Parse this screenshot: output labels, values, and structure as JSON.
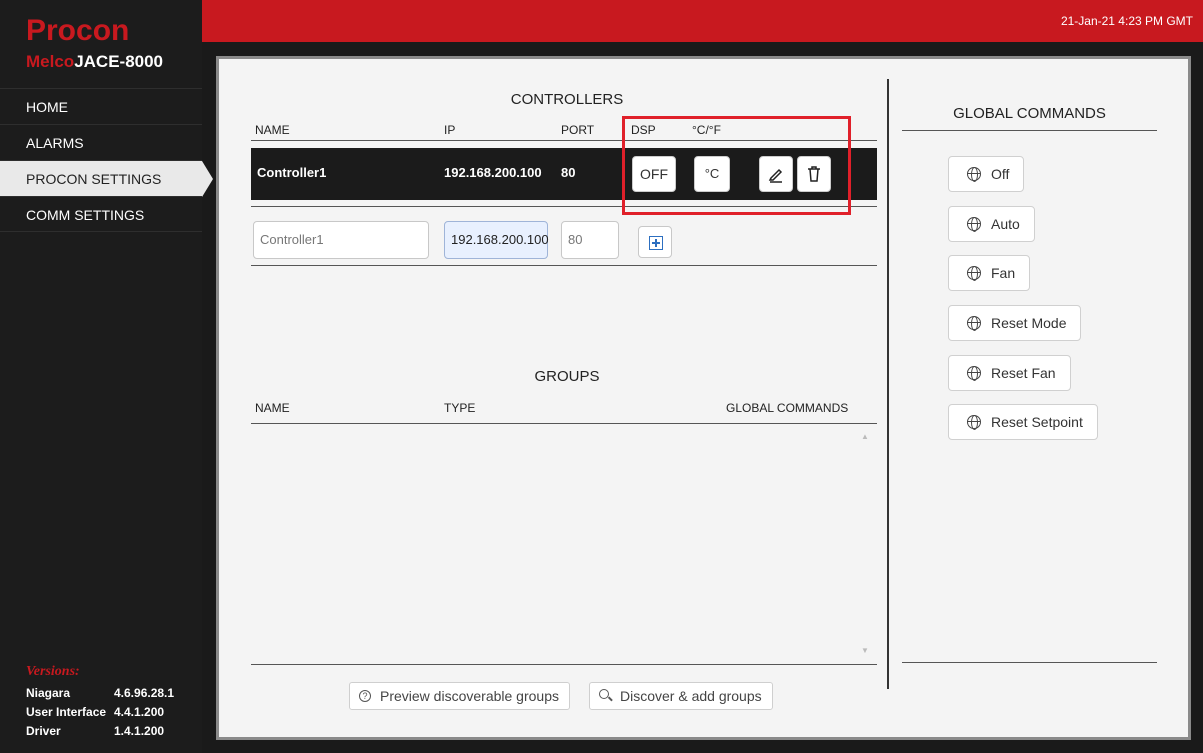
{
  "brand": {
    "name": "Procon",
    "model_prefix": "Melco",
    "model_suffix": "JACE-8000"
  },
  "datetime": "21-Jan-21 4:23 PM GMT",
  "nav": [
    {
      "label": "HOME"
    },
    {
      "label": "ALARMS"
    },
    {
      "label": "PROCON SETTINGS",
      "active": true
    },
    {
      "label": "COMM SETTINGS"
    }
  ],
  "versions": {
    "title": "Versions:",
    "rows": [
      {
        "name": "Niagara",
        "value": "4.6.96.28.1"
      },
      {
        "name": "User Interface",
        "value": "4.4.1.200"
      },
      {
        "name": "Driver",
        "value": "1.4.1.200"
      }
    ]
  },
  "controllers": {
    "title": "CONTROLLERS",
    "headers": {
      "name": "NAME",
      "ip": "IP",
      "port": "PORT",
      "dsp": "DSP",
      "unit": "°C/°F"
    },
    "row": {
      "name": "Controller1",
      "ip": "192.168.200.100",
      "port": "80",
      "dsp_button": "OFF",
      "unit_button": "°C"
    },
    "new_entry": {
      "name_placeholder": "Controller1",
      "ip_value": "192.168.200.100",
      "port_placeholder": "80"
    }
  },
  "groups": {
    "title": "GROUPS",
    "headers": {
      "name": "NAME",
      "type": "TYPE",
      "global": "GLOBAL COMMANDS"
    },
    "preview_button": "Preview discoverable groups",
    "discover_button": "Discover & add groups"
  },
  "global_commands": {
    "title": "GLOBAL COMMANDS",
    "buttons": [
      "Off",
      "Auto",
      "Fan",
      "Reset Mode",
      "Reset Fan",
      "Reset Setpoint"
    ]
  },
  "colors": {
    "accent": "#c8191f",
    "sidebar": "#1c1c1c",
    "highlight": "#e0202a"
  }
}
